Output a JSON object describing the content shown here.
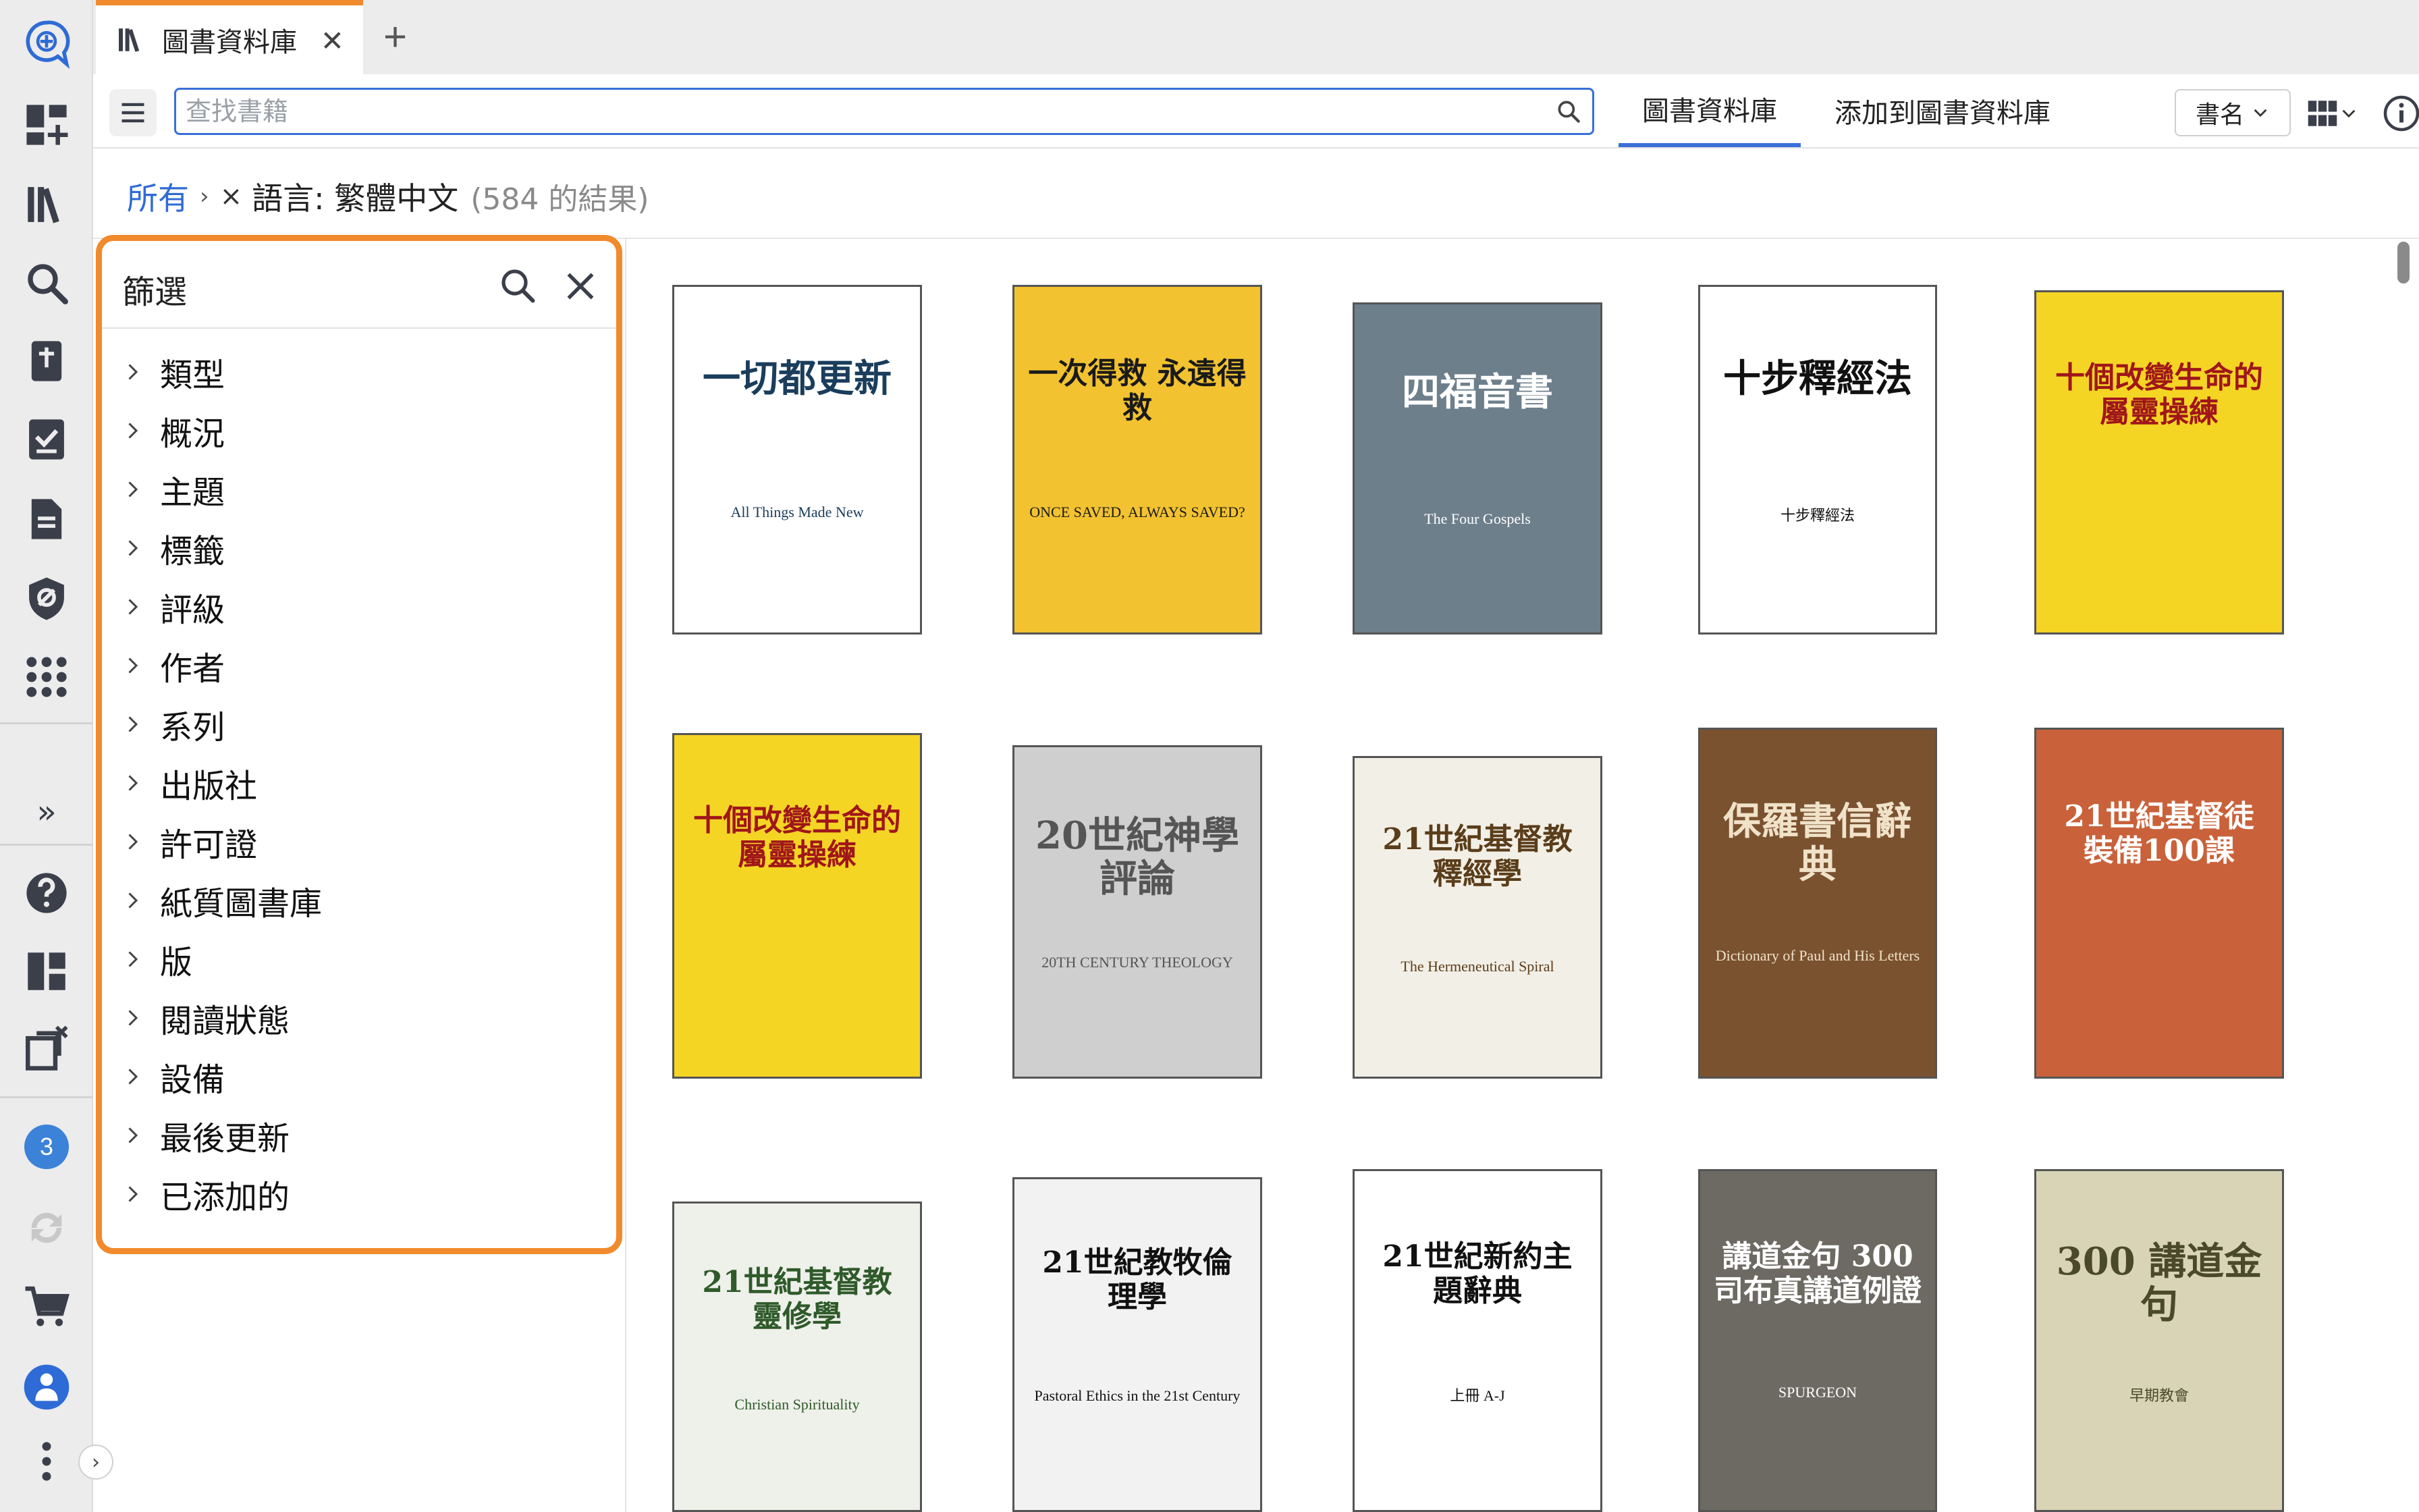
{
  "rail": {
    "items": [
      {
        "name": "logos-home-icon"
      },
      {
        "name": "dashboard-add-icon"
      },
      {
        "name": "library-icon"
      },
      {
        "name": "search-icon"
      },
      {
        "name": "bible-icon"
      },
      {
        "name": "checklist-icon"
      },
      {
        "name": "document-icon"
      },
      {
        "name": "shield-icon"
      },
      {
        "name": "apps-grid-icon"
      }
    ],
    "expand_label": "»",
    "badge_count": "3",
    "collapse_label": "›"
  },
  "tab": {
    "label": "圖書資料庫",
    "close": "✕",
    "add": "+"
  },
  "toolbar": {
    "search_placeholder": "查找書籍",
    "tabs": [
      "圖書資料庫",
      "添加到圖書資料庫"
    ],
    "sort_label": "書名",
    "accent_color": "#3a6fd8"
  },
  "breadcrumb": {
    "all": "所有",
    "separator": "›",
    "remove": "×",
    "filter": "語言: 繁體中文",
    "count": "(584 的結果)"
  },
  "filter_panel": {
    "title": "篩選",
    "border_color": "#f08a2c",
    "items": [
      "類型",
      "概況",
      "主題",
      "標籤",
      "評級",
      "作者",
      "系列",
      "出版社",
      "許可證",
      "紙質圖書庫",
      "版",
      "閱讀狀態",
      "設備",
      "最後更新",
      "已添加的"
    ]
  },
  "books": [
    {
      "title": "一切都更新",
      "subtitle": "All Things Made New",
      "bg": "#ffffff",
      "fg": "#1a3d5c"
    },
    {
      "title": "一次得救 永遠得救",
      "subtitle": "ONCE SAVED, ALWAYS SAVED?",
      "bg": "#f2c230",
      "fg": "#1a1a1a"
    },
    {
      "title": "四福音書",
      "subtitle": "The Four Gospels",
      "bg": "#6e7f8c",
      "fg": "#ffffff"
    },
    {
      "title": "十步釋經法",
      "subtitle": "十步釋經法",
      "bg": "#ffffff",
      "fg": "#111111"
    },
    {
      "title": "十個改變生命的屬靈操練",
      "subtitle": "",
      "bg": "#f5d524",
      "fg": "#a0161a"
    },
    {
      "title": "十個改變生命的屬靈操練",
      "subtitle": "",
      "bg": "#f5d524",
      "fg": "#a0161a"
    },
    {
      "title": "20世紀神學評論",
      "subtitle": "20TH CENTURY THEOLOGY",
      "bg": "#cfcfcf",
      "fg": "#555555"
    },
    {
      "title": "21世紀基督教釋經學",
      "subtitle": "The Hermeneutical Spiral",
      "bg": "#f2efe6",
      "fg": "#5a3d1a"
    },
    {
      "title": "保羅書信辭典",
      "subtitle": "Dictionary of Paul and His Letters",
      "bg": "#7a5230",
      "fg": "#f0e2c8"
    },
    {
      "title": "21世紀基督徒裝備100課",
      "subtitle": "",
      "bg": "#c9623a",
      "fg": "#ffffff"
    },
    {
      "title": "21世紀基督教靈修學",
      "subtitle": "Christian Spirituality",
      "bg": "#eef0ea",
      "fg": "#2f5a2a"
    },
    {
      "title": "21世紀教牧倫理學",
      "subtitle": "Pastoral Ethics in the 21st Century",
      "bg": "#f2f2f2",
      "fg": "#111111"
    },
    {
      "title": "21世紀新約主題辭典",
      "subtitle": "上冊 A-J",
      "bg": "#ffffff",
      "fg": "#111111"
    },
    {
      "title": "講道金句 300 司布真講道例證",
      "subtitle": "SPURGEON",
      "bg": "#6d6a63",
      "fg": "#ffffff"
    },
    {
      "title": "300 講道金句",
      "subtitle": "早期教會",
      "bg": "#d9d4b6",
      "fg": "#4a4a2a"
    }
  ]
}
